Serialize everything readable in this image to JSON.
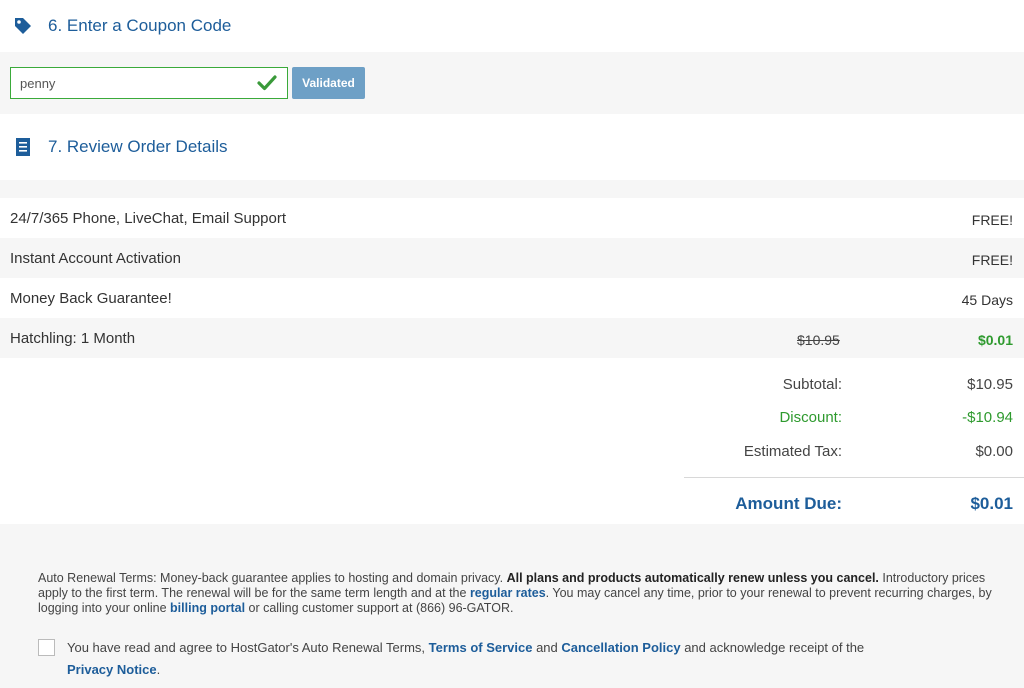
{
  "coupon_section": {
    "title": "6. Enter a Coupon Code",
    "input_value": "penny",
    "validated_label": "Validated"
  },
  "review_section": {
    "title": "7. Review Order Details"
  },
  "order_rows": [
    {
      "label": "24/7/365 Phone, LiveChat, Email Support",
      "value": "FREE!"
    },
    {
      "label": "Instant Account Activation",
      "value": "FREE!"
    },
    {
      "label": "Money Back Guarantee!",
      "value": "45 Days"
    },
    {
      "label": "Hatchling: 1 Month",
      "original_price": "$10.95",
      "value": "$0.01"
    }
  ],
  "totals": {
    "subtotal_label": "Subtotal:",
    "subtotal_value": "$10.95",
    "discount_label": "Discount:",
    "discount_value": "-$10.94",
    "tax_label": "Estimated Tax:",
    "tax_value": "$0.00",
    "due_label": "Amount Due:",
    "due_value": "$0.01"
  },
  "terms": {
    "part1": "Auto Renewal Terms: Money-back guarantee applies to hosting and domain privacy. ",
    "bold": "All plans and products automatically renew unless you cancel.",
    "part2": " Introductory prices apply to the first term. The renewal will be for the same term length and at the ",
    "regular_rates_link": "regular rates",
    "part3": ". You may cancel any time, prior to your renewal to prevent recurring charges, by logging into your online ",
    "billing_portal_link": "billing portal",
    "part4": " or calling customer support at (866) 96-GATOR."
  },
  "agreement": {
    "part1": "You have read and agree to HostGator's Auto Renewal Terms, ",
    "tos_link": "Terms of Service",
    "and": " and ",
    "cancellation_link": "Cancellation Policy",
    "part2": " and acknowledge receipt of the ",
    "privacy_link": "Privacy Notice",
    "period": "."
  },
  "colors": {
    "accent": "#1d5d9a",
    "success": "#2e9a2e",
    "button": "#6ea0c6",
    "band": "#f6f6f6"
  },
  "icons": [
    "tag-icon",
    "checkmark-icon",
    "receipt-icon"
  ]
}
